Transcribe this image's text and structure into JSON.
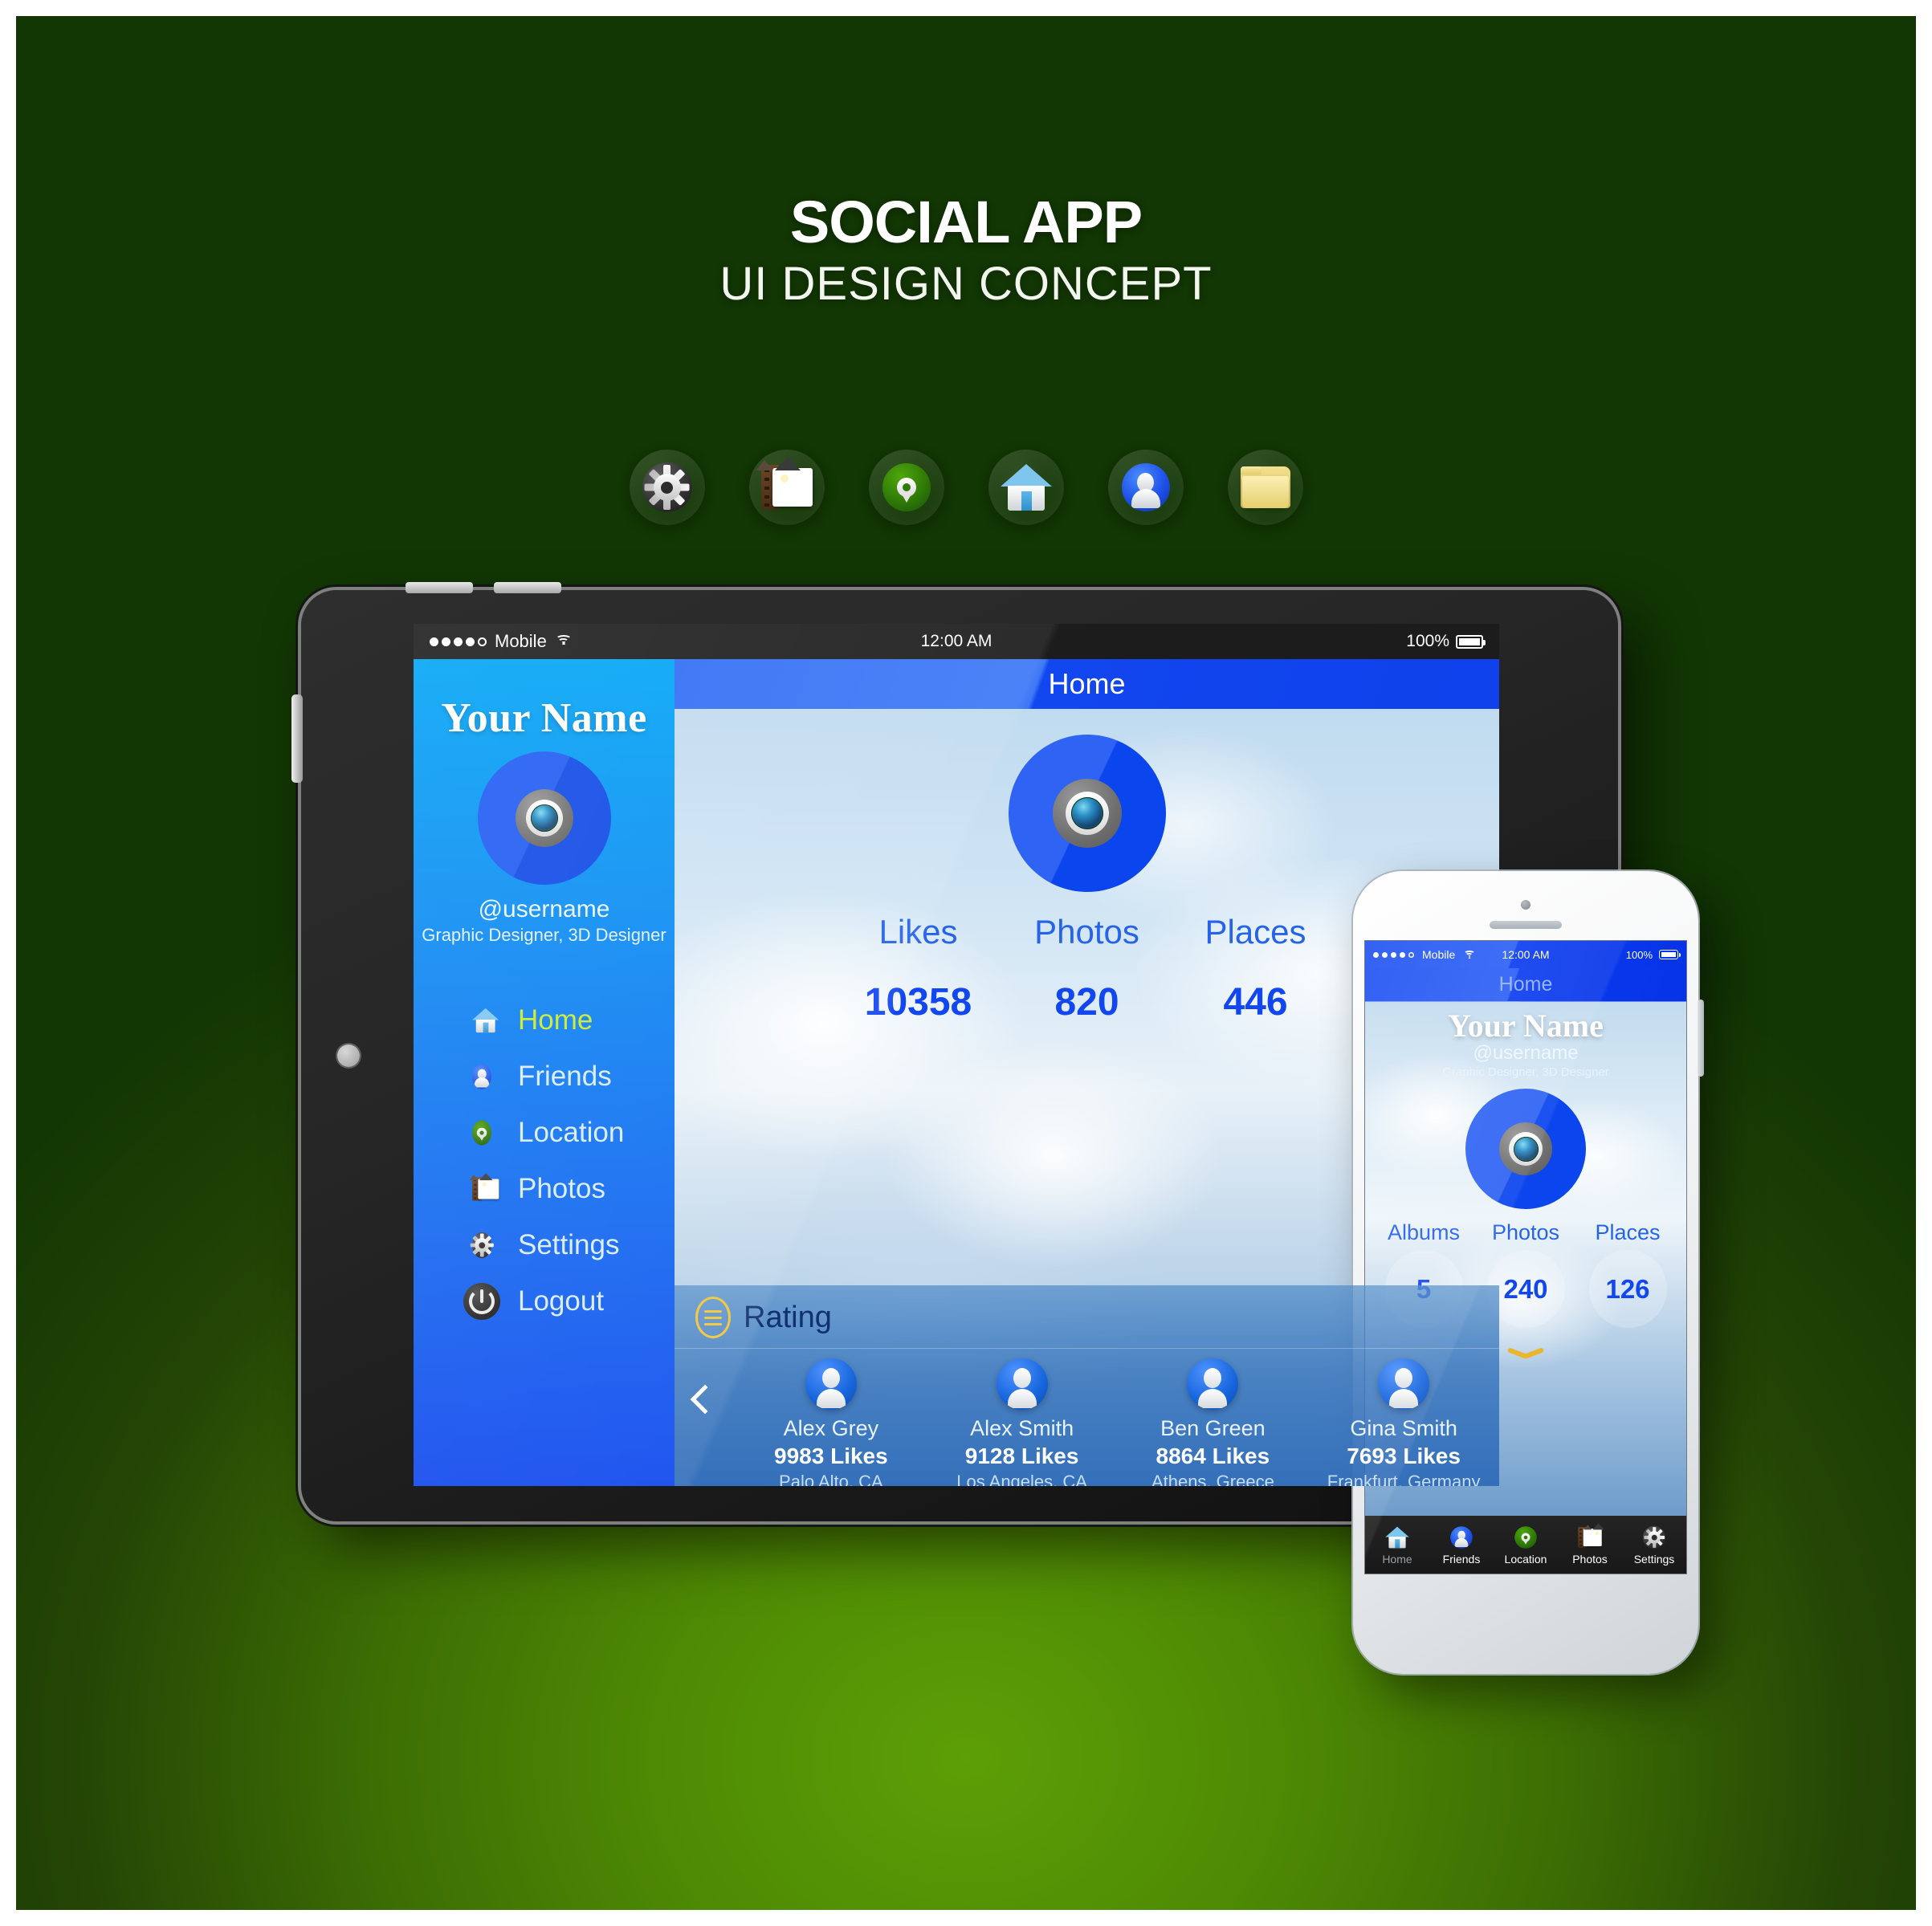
{
  "header": {
    "title": "SOCIAL APP",
    "subtitle": "UI DESIGN CONCEPT",
    "icons": [
      {
        "name": "gear-icon",
        "label": "Settings"
      },
      {
        "name": "photos-icon",
        "label": "Photos"
      },
      {
        "name": "location-pin-icon",
        "label": "Location"
      },
      {
        "name": "home-icon",
        "label": "Home"
      },
      {
        "name": "person-icon",
        "label": "Friends"
      },
      {
        "name": "folder-icon",
        "label": "Folder"
      }
    ]
  },
  "tablet": {
    "status_bar": {
      "carrier": "Mobile",
      "signal_dots_filled": 4,
      "signal_dots_total": 5,
      "wifi": "wifi-icon",
      "time": "12:00 AM",
      "battery_percent": "100%"
    },
    "sidebar": {
      "name": "Your Name",
      "avatar": "camera-lens-avatar",
      "username": "@username",
      "role": "Graphic Designer, 3D Designer",
      "nav": [
        {
          "label": "Home",
          "icon": "home-icon",
          "active": true
        },
        {
          "label": "Friends",
          "icon": "person-icon",
          "active": false
        },
        {
          "label": "Location",
          "icon": "location-pin-icon",
          "active": false
        },
        {
          "label": "Photos",
          "icon": "photos-icon",
          "active": false
        },
        {
          "label": "Settings",
          "icon": "gear-icon",
          "active": false
        },
        {
          "label": "Logout",
          "icon": "power-icon",
          "active": false
        }
      ]
    },
    "main": {
      "title": "Home",
      "avatar": "camera-lens-avatar",
      "stats": [
        {
          "label": "Likes",
          "value": "10358"
        },
        {
          "label": "Photos",
          "value": "820"
        },
        {
          "label": "Places",
          "value": "446"
        }
      ],
      "rating": {
        "menu_icon": "hamburger-icon",
        "title": "Rating",
        "prev_icon": "chevron-left-icon",
        "cards": [
          {
            "name": "Alex Grey",
            "likes": "9983 Likes",
            "place": "Palo Alto, CA"
          },
          {
            "name": "Alex Smith",
            "likes": "9128 Likes",
            "place": "Los Angeles, CA"
          },
          {
            "name": "Ben Green",
            "likes": "8864 Likes",
            "place": "Athens, Greece"
          },
          {
            "name": "Gina Smith",
            "likes": "7693 Likes",
            "place": "Frankfurt, Germany"
          }
        ]
      }
    }
  },
  "phone": {
    "status_bar": {
      "carrier": "Mobile",
      "time": "12:00 AM",
      "battery_percent": "100%"
    },
    "title": "Home",
    "name": "Your Name",
    "username": "@username",
    "role": "Graphic Designer, 3D Designer",
    "avatar": "camera-lens-avatar",
    "stats": [
      {
        "label": "Albums",
        "value": "5"
      },
      {
        "label": "Photos",
        "value": "240"
      },
      {
        "label": "Places",
        "value": "126"
      }
    ],
    "expand_icon": "chevron-down-icon",
    "tabs": [
      {
        "label": "Home",
        "icon": "home-icon",
        "active": true
      },
      {
        "label": "Friends",
        "icon": "person-icon",
        "active": false
      },
      {
        "label": "Location",
        "icon": "location-pin-icon",
        "active": false
      },
      {
        "label": "Photos",
        "icon": "photos-icon",
        "active": false
      },
      {
        "label": "Settings",
        "icon": "gear-icon",
        "active": false
      }
    ]
  },
  "colors": {
    "background_green_dark": "#123604",
    "background_green_light": "#529204",
    "accent_blue": "#1247f0",
    "sidebar_blue_top": "#00a5f5",
    "sidebar_blue_bottom": "#1148ee",
    "active_nav_green": "#c8ea2a",
    "rating_accent_yellow": "#f3c53a"
  }
}
